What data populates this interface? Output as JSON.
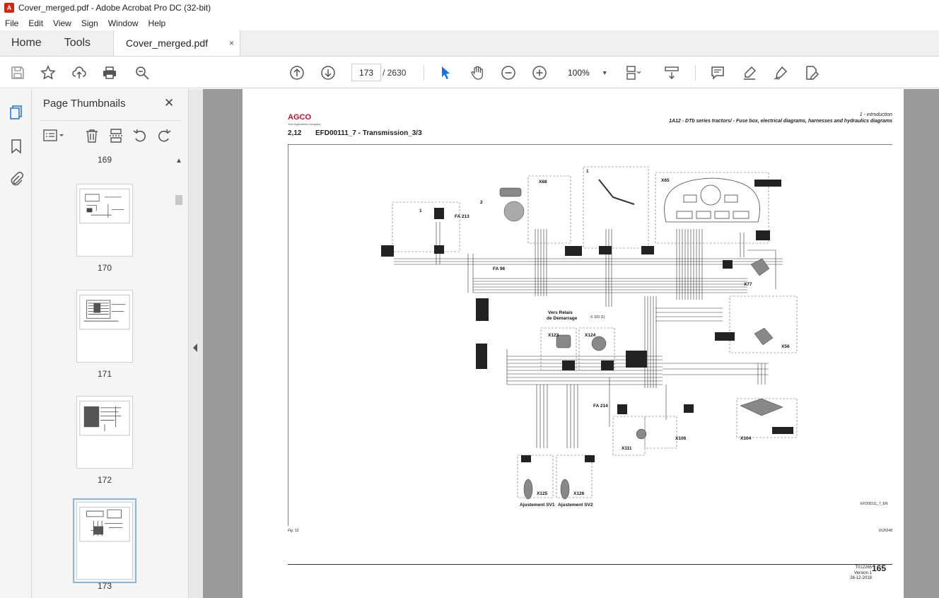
{
  "window": {
    "title": "Cover_merged.pdf - Adobe Acrobat Pro DC (32-bit)",
    "app_icon_glyph": "A"
  },
  "menu": [
    "File",
    "Edit",
    "View",
    "Sign",
    "Window",
    "Help"
  ],
  "tabs": {
    "home": "Home",
    "tools": "Tools",
    "document": "Cover_merged.pdf",
    "close_glyph": "×"
  },
  "toolbar": {
    "page_current": "173",
    "page_total": "/ 2630",
    "zoom": "100%",
    "zoom_caret": "▼",
    "icons": [
      "save-icon",
      "bookmark-star-icon",
      "upload-icon",
      "print-icon",
      "zoom-search-icon",
      "page-up-icon",
      "page-down-icon",
      "select-pointer-icon",
      "hand-icon",
      "zoom-out-icon",
      "zoom-in-icon",
      "page-layout-icon",
      "scroll-mode-icon",
      "comment-icon",
      "highlight-icon",
      "sign-icon",
      "edit-pdf-icon"
    ],
    "accent_color": "#1473e6"
  },
  "rail": {
    "icons": [
      "page-thumbnails-icon",
      "bookmarks-icon",
      "attachments-icon"
    ]
  },
  "thumbnails": {
    "title": "Page Thumbnails",
    "close_glyph": "✕",
    "scroll_up_glyph": "▲",
    "tool_icons": [
      "options-menu-icon",
      "delete-icon",
      "extract-icon",
      "rotate-left-icon",
      "rotate-right-icon"
    ],
    "top_partial_label": "169",
    "pages": [
      {
        "label": "170",
        "selected": false
      },
      {
        "label": "171",
        "selected": false
      },
      {
        "label": "172",
        "selected": false
      },
      {
        "label": "173",
        "selected": true
      }
    ]
  },
  "page": {
    "logo": "AGCO",
    "logo_sub": "Your Agriculture Company",
    "section_intro": "1 - introduction",
    "header": "1A12 - DTb series tractors/ - Fuse box, electrical diagrams, harnesses and hydraulics diagrams",
    "section_number": "2,12",
    "section_title": "EFD00111_7 - Transmission_3/3",
    "fig_caption": "Fig. 12.",
    "fig_id": "1526248",
    "diagram_ref": "EFD00111_7_EN",
    "doc_code": "T012265",
    "doc_version": "Version 1",
    "doc_date": "26-12-2018",
    "page_number": "165",
    "diagram_labels": {
      "x68": "X68",
      "x65": "X65",
      "x77": "X77",
      "x56": "X56",
      "x123": "X123",
      "x124": "X124",
      "x111": "X111",
      "x106": "X106",
      "x104": "X104",
      "x125": "X125",
      "x126": "X126",
      "adj1": "Ajustement SV1",
      "adj2": "Ajustement SV2",
      "start_inhibit_1": "Vers Relais",
      "start_inhibit_2": "de Demarrage",
      "x103": "X 103 (1)",
      "fa213": "FA 213",
      "fa214": "FA 214",
      "fa96": "FA 96",
      "callout1": "1",
      "callout2": "2",
      "callout3": "1"
    }
  }
}
